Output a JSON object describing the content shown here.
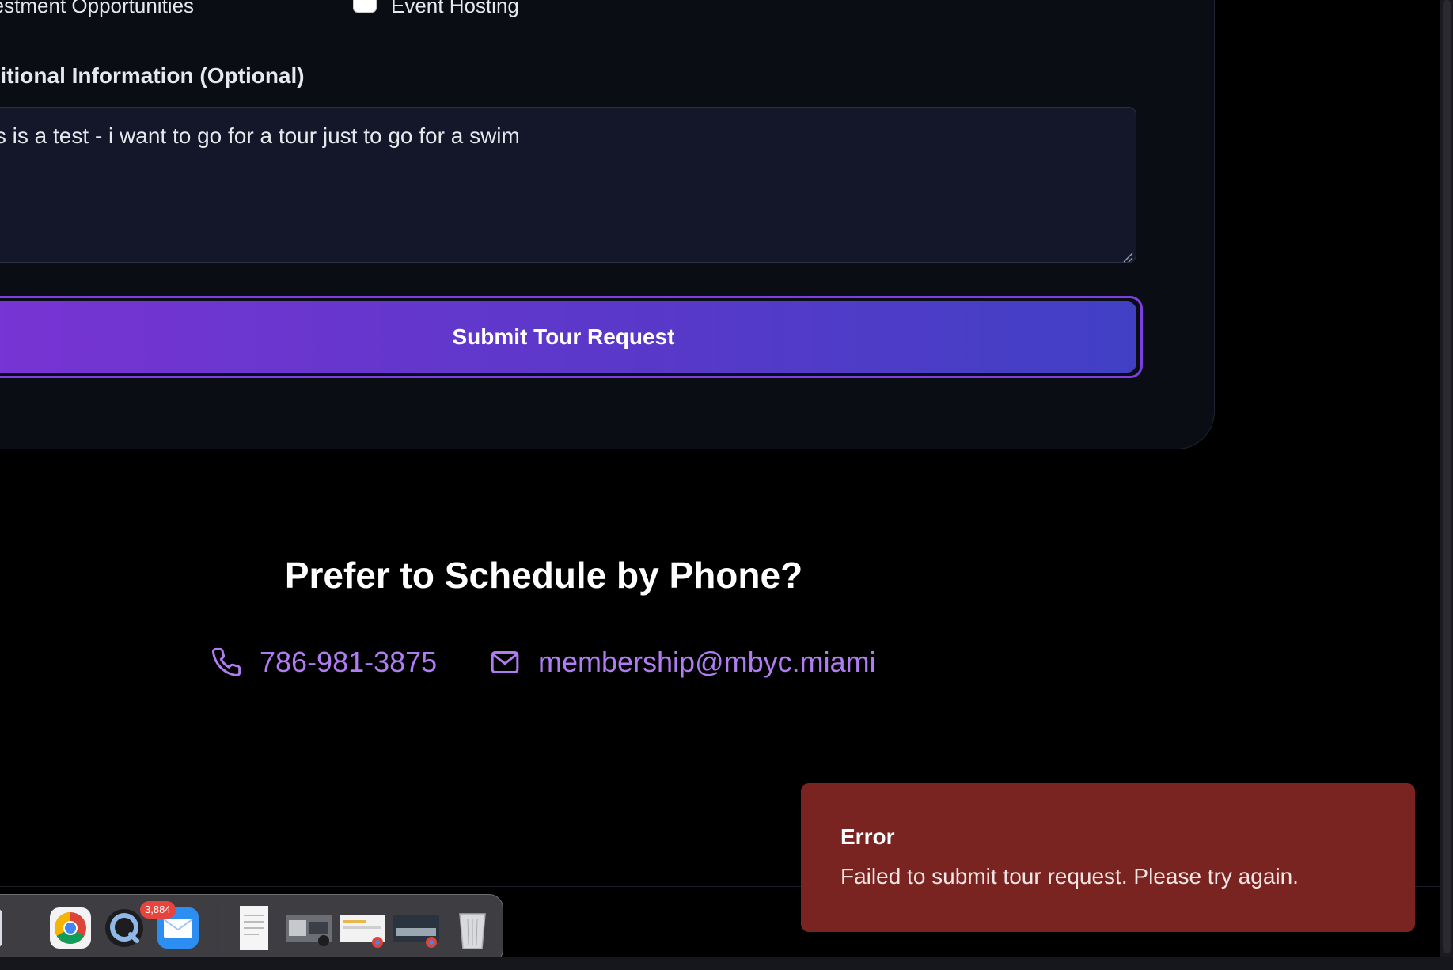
{
  "form": {
    "checkbox_investment_label": "Investment Opportunities",
    "checkbox_event_label": "Event Hosting",
    "additional_info_label": "Additional Information (Optional)",
    "additional_info_value": "This is a test - i want to go for a tour just to go for a swim",
    "submit_label": "Submit Tour Request"
  },
  "contact": {
    "heading": "Prefer to Schedule by Phone?",
    "phone": "786-981-3875",
    "email": "membership@mbyc.miami",
    "phone_icon": "phone-icon",
    "email_icon": "mail-icon"
  },
  "toast": {
    "title": "Error",
    "message": "Failed to submit tour request. Please try again."
  },
  "dock": {
    "mail_badge": "3,884",
    "items": [
      "finder-icon",
      "chrome-icon",
      "quicktime-icon",
      "mail-icon",
      "document-icon",
      "photo-preview-icon",
      "chrome-window-icon",
      "chrome-window-icon",
      "trash-icon"
    ]
  },
  "colors": {
    "accent_purple": "#b07cf2",
    "button_gradient_start": "#7834d4",
    "button_gradient_end": "#4140c5",
    "error_bg": "#7a2421",
    "card_bg": "#0a0d14"
  }
}
